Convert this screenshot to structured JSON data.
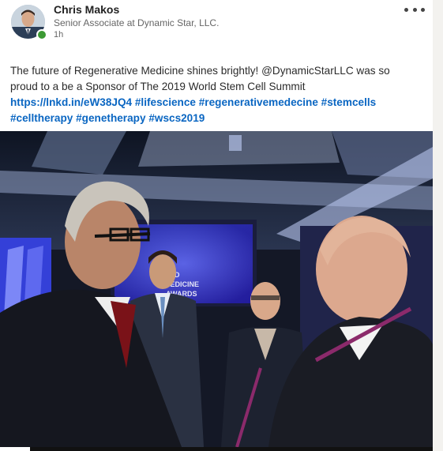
{
  "post": {
    "author": {
      "name": "Chris Makos",
      "headline": "Senior Associate at Dynamic Star, LLC.",
      "time": "1h",
      "status": "online"
    },
    "more_icon": "more-horizontal-icon",
    "text": {
      "line1": "The future of Regenerative Medicine shines brightly! @DynamicStarLLC was so",
      "line2": "proud to a be a Sponsor of The 2019 World Stem Cell Summit",
      "link": "https://lnkd.in/eW38JQ4",
      "tags_line1": [
        "#lifescience",
        "#regenerativemedecine",
        "#stemcells"
      ],
      "tags_line2": [
        "#celltherapy",
        "#genetherapy",
        "#wscs2019"
      ]
    },
    "photo": {
      "screen_text": "AND\nMEDICINE\nACT... AWARDS"
    }
  },
  "colors": {
    "link": "#0a66c2",
    "presence": "#3c9a34",
    "stage_blue": "#3a2bd6"
  }
}
